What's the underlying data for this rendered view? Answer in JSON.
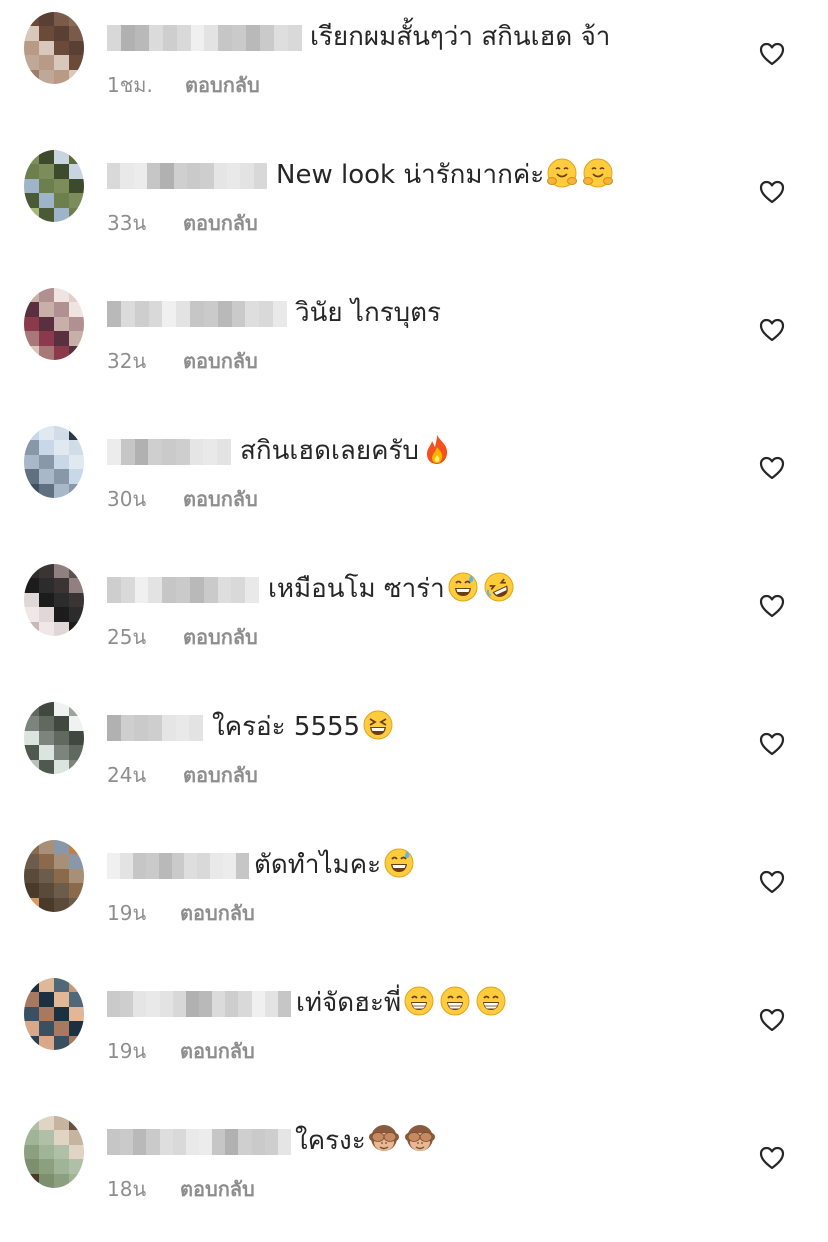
{
  "comments": [
    {
      "text": "เรียกผมสั้นๆว่า สกินเฮด จ้า",
      "emojis": [],
      "time": "1ชม.",
      "reply": "ตอบกลับ"
    },
    {
      "text": "New look น่ารักมากค่ะ",
      "emojis": [
        "hugging-face-emoji",
        "hugging-face-emoji"
      ],
      "time": "33น",
      "reply": "ตอบกลับ"
    },
    {
      "text": "วินัย ไกรบุตร",
      "emojis": [],
      "time": "32น",
      "reply": "ตอบกลับ"
    },
    {
      "text": "สกินเฮดเลยครับ",
      "emojis": [
        "fire-emoji"
      ],
      "time": "30น",
      "reply": "ตอบกลับ"
    },
    {
      "text": "เหมือนโม ซาร่า",
      "emojis": [
        "grinning-sweat-emoji",
        "rolling-laughing-emoji"
      ],
      "time": "25น",
      "reply": "ตอบกลับ"
    },
    {
      "text": "ใครอ่ะ 5555",
      "emojis": [
        "squinting-laugh-emoji"
      ],
      "time": "24น",
      "reply": "ตอบกลับ"
    },
    {
      "text": "ตัดทำไมคะ",
      "emojis": [
        "grinning-sweat-emoji"
      ],
      "time": "19น",
      "reply": "ตอบกลับ"
    },
    {
      "text": "เท่จัดฮะพี่",
      "emojis": [
        "beaming-smile-emoji",
        "beaming-smile-emoji",
        "beaming-smile-emoji"
      ],
      "time": "19น",
      "reply": "ตอบกลับ"
    },
    {
      "text": "ใครงะ",
      "emojis": [
        "see-no-evil-monkey-emoji",
        "see-no-evil-monkey-emoji"
      ],
      "time": "18น",
      "reply": "ตอบกลับ"
    }
  ],
  "icons": {
    "like": "heart-outline-icon"
  },
  "colors": {
    "text": "#262626",
    "secondary": "#8e8e8e",
    "background": "#ffffff"
  }
}
